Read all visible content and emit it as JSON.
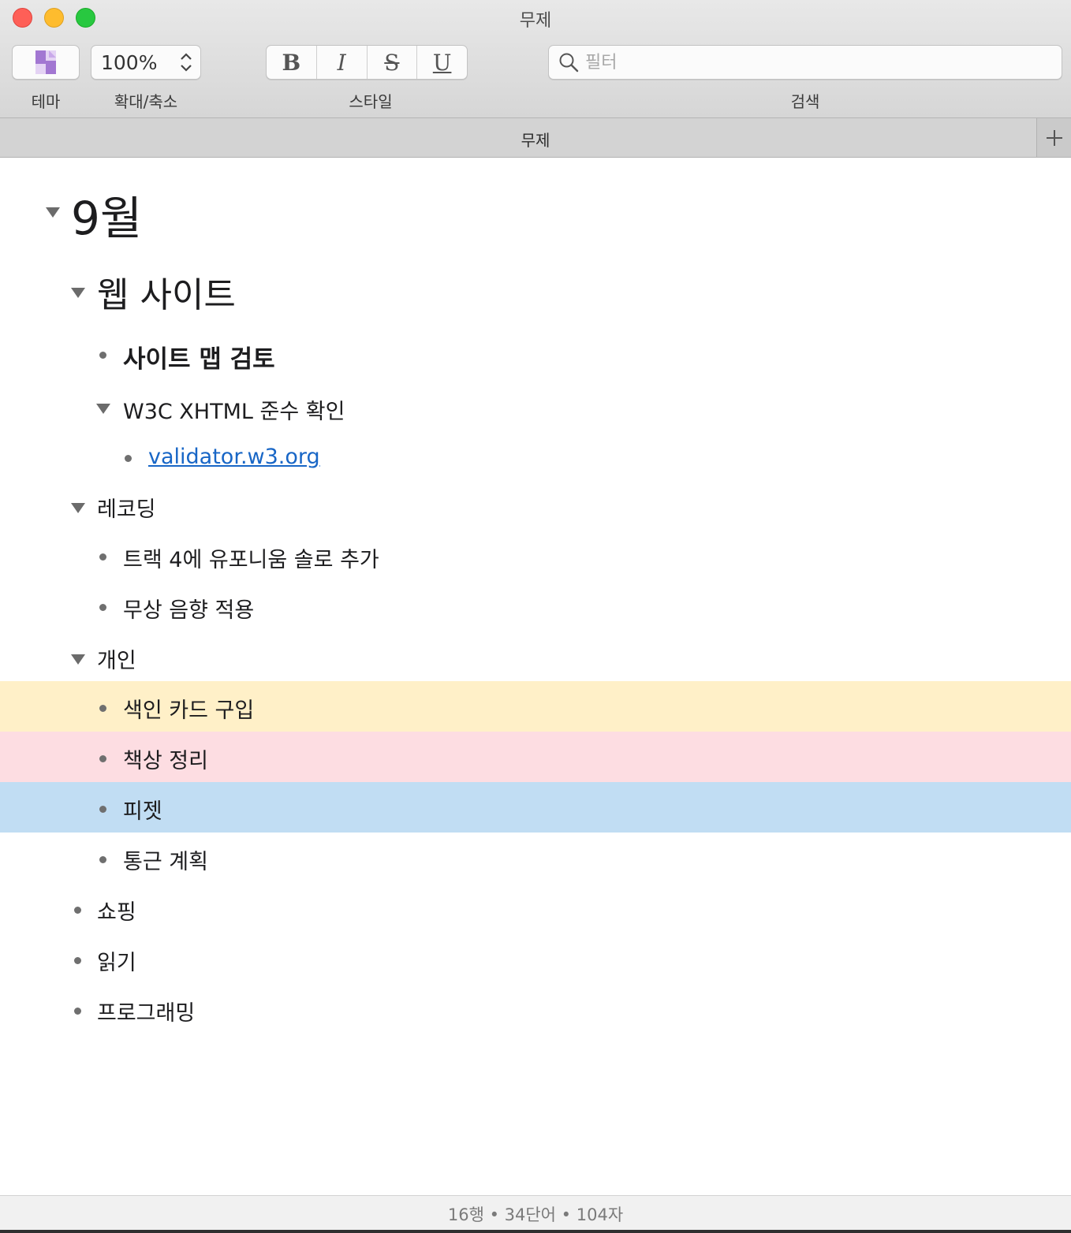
{
  "window": {
    "title": "무제"
  },
  "toolbar": {
    "theme_label": "테마",
    "zoom_value": "100%",
    "zoom_label": "확대/축소",
    "style_buttons": [
      "B",
      "I",
      "S",
      "U"
    ],
    "style_label": "스타일",
    "search_placeholder": "필터",
    "search_label": "검색"
  },
  "tab": {
    "title": "무제"
  },
  "outline": {
    "items": [
      {
        "text": "9월"
      },
      {
        "text": "웹 사이트"
      },
      {
        "text": "사이트 맵 검토"
      },
      {
        "text": "W3C XHTML 준수 확인"
      },
      {
        "text": "validator.w3.org"
      },
      {
        "text": "레코딩"
      },
      {
        "text": "트랙 4에 유포니움 솔로 추가"
      },
      {
        "text": "무상 음향 적용"
      },
      {
        "text": "개인"
      },
      {
        "text": "색인 카드 구입"
      },
      {
        "text": "책상 정리"
      },
      {
        "text": "피젯"
      },
      {
        "text": "통근 계획"
      },
      {
        "text": "쇼핑"
      },
      {
        "text": "읽기"
      },
      {
        "text": "프로그래밍"
      }
    ],
    "highlight_colors": {
      "yellow": "#fff0c8",
      "pink": "#fddde2",
      "blue": "#c1ddf3"
    }
  },
  "status": {
    "text": "16행 • 34단어 • 104자"
  },
  "colors": {
    "link": "#1866c6",
    "close": "#fe5f57",
    "minimize": "#febc2e",
    "zoom": "#28c840"
  }
}
